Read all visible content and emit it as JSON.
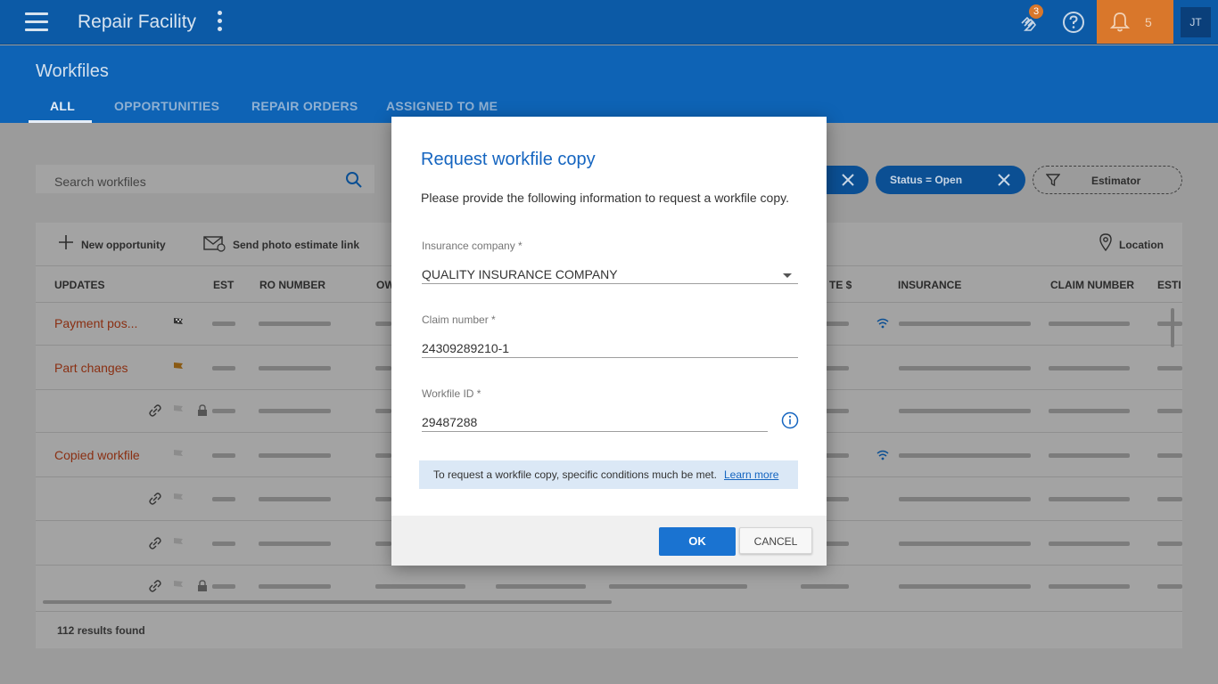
{
  "app": {
    "title": "Repair Facility",
    "hands_badge": "3",
    "notif_count": "5",
    "avatar_initials": "JT"
  },
  "page": {
    "title": "Workfiles",
    "tabs": [
      {
        "label": "ALL"
      },
      {
        "label": "OPPORTUNITIES"
      },
      {
        "label": "REPAIR ORDERS"
      },
      {
        "label": "ASSIGNED TO ME"
      }
    ]
  },
  "filters": {
    "search_placeholder": "Search workfiles",
    "chip_status": "Status = Open",
    "chip_estimator": "Estimator"
  },
  "toolbar": {
    "new_opportunity": "New opportunity",
    "send_photo": "Send photo estimate link",
    "location": "Location"
  },
  "table": {
    "headers": {
      "updates": "UPDATES",
      "est": "EST",
      "ro_number": "RO NUMBER",
      "owner": "OW",
      "estimate": "TE $",
      "insurance": "INSURANCE",
      "claim_number": "CLAIM NUMBER",
      "estimator": "ESTI"
    },
    "rows": [
      {
        "update": "Payment pos..."
      },
      {
        "update": "Part changes"
      },
      {
        "update": ""
      },
      {
        "update": "Copied workfile"
      },
      {
        "update": ""
      },
      {
        "update": ""
      },
      {
        "update": ""
      }
    ],
    "results": "112 results found"
  },
  "dialog": {
    "title": "Request workfile copy",
    "description": "Please provide the following information to request a workfile copy.",
    "insurance_label": "Insurance company *",
    "insurance_value": "QUALITY INSURANCE COMPANY",
    "claim_label": "Claim number *",
    "claim_value": "24309289210-1",
    "workfile_label": "Workfile ID *",
    "workfile_value": "29487288",
    "notice": "To request a workfile copy, specific conditions much be met.",
    "learn_more": "Learn more",
    "ok": "OK",
    "cancel": "CANCEL"
  },
  "colors": {
    "appbar": "#0c5aa6",
    "accent_orange": "#d9772b",
    "dialog_title": "#1565c0",
    "ok_button": "#1a73d1"
  }
}
